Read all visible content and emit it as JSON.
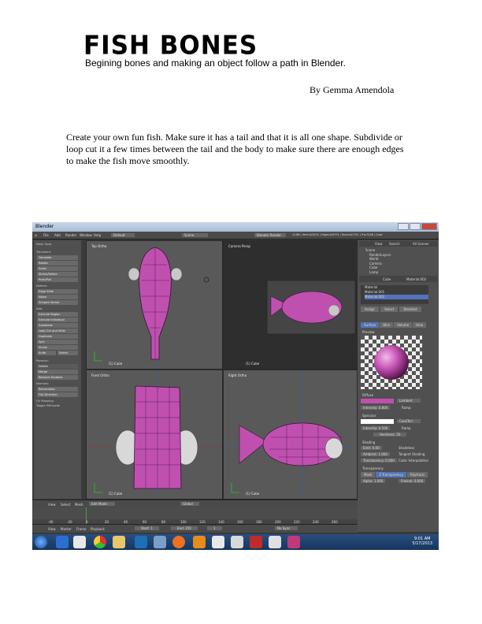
{
  "heading": {
    "title": "FISH BONES",
    "subtitle": "Begining bones and making an object follow a path in Blender.",
    "author": "By Gemma Amendola"
  },
  "instructions": "Create your own fun fish. Make sure it has a tail and that it is all one shape. Subdivide or loop cut it a few times between the tail and the body to make sure there are enough edges to make the fish move smoothly.",
  "screenshot": {
    "window_title": "Blender",
    "menu": [
      "File",
      "Add",
      "Render",
      "Window",
      "Help"
    ],
    "layout": "Default",
    "scene": "Scene",
    "engine": "Blender Render",
    "stats": "v2.66 | Verts:0/2034 | Edges:0/3374 | Faces:0/1752 | Tris:3248 | Cube",
    "tools_header": "Mesh Tools",
    "tool_sections": [
      {
        "heading": "Transform:",
        "items": [
          "Translate",
          "Rotate",
          "Scale",
          "Shrink/Fatten",
          "Push/Pull"
        ]
      },
      {
        "heading": "Deform:",
        "items": [
          "Edge Slide",
          "Noise",
          "Smooth Vertex"
        ]
      },
      {
        "heading": "Add:",
        "items": [
          "Extrude Region",
          "Extrude Individual",
          "Subdivide",
          "Loop Cut and Slide",
          "Duplicate",
          "Spin",
          "Screw",
          "Knife"
        ]
      },
      {
        "heading": "Remove:",
        "items": [
          "Delete",
          "Merge",
          "Remove Doubles"
        ]
      },
      {
        "heading": "Normals:",
        "items": [
          "Recalculate",
          "Flip Direction"
        ]
      },
      {
        "heading": "UV Mapping:",
        "items": []
      }
    ],
    "toggle_editmode": "Toggle Editmode",
    "knife_select": "Select",
    "viewports": [
      {
        "label": "Top Ortho",
        "obj": "(1) Cube"
      },
      {
        "label": "Camera Persp",
        "obj": "(1) Cube"
      },
      {
        "label": "Front Ortho",
        "obj": "(1) Cube"
      },
      {
        "label": "Right Ortho",
        "obj": "(1) Cube"
      }
    ],
    "view_bar": [
      "View",
      "Select",
      "Mesh",
      "Edit Mode",
      "Global"
    ],
    "outliner": {
      "tabs": [
        "View",
        "Search",
        "All Scenes"
      ],
      "items": [
        "Scene",
        "RenderLayers",
        "World",
        "Camera",
        "Cube",
        "Lamp"
      ]
    },
    "material_object": "Cube",
    "material_name": "Material.002",
    "materials": [
      "Material",
      "Material.001",
      "Material.002"
    ],
    "material_buttons": [
      "Assign",
      "Select",
      "Deselect"
    ],
    "material_tabs": [
      "Surface",
      "Wire",
      "Volume",
      "Halo"
    ],
    "preview_label": "Preview",
    "diffuse": {
      "label": "Diffuse",
      "shader": "Lambert",
      "intensity": "Intensity: 0.800",
      "ramp": "Ramp"
    },
    "specular": {
      "label": "Specular",
      "shader": "CookTorr",
      "intensity": "Intensity: 0.500",
      "ramp": "Ramp",
      "hardness": "Hardness: 50"
    },
    "shading": {
      "label": "Shading",
      "emit": "Emit: 0.00",
      "ambient": "Ambient: 1.000",
      "translucency": "Translucency: 0.000",
      "shadeless": "Shadeless",
      "tangent": "Tangent Shading",
      "cubic": "Cubic Interpolation"
    },
    "transparency": {
      "label": "Transparency",
      "tabs": [
        "Mask",
        "Z Transparency",
        "Raytrace"
      ],
      "alpha": "Alpha: 1.000",
      "fresnel": "Fresnel: 0.000"
    },
    "timeline_bar": [
      "View",
      "Marker",
      "Frame",
      "Playback"
    ],
    "start": "Start: 1",
    "end": "End: 250",
    "current_frame": "1",
    "sync": "No Sync",
    "ruler_ticks": [
      "-40",
      "-20",
      "0",
      "20",
      "40",
      "60",
      "80",
      "100",
      "120",
      "140",
      "160",
      "180",
      "200",
      "220",
      "240",
      "260"
    ],
    "clock_time": "9:01 AM",
    "clock_date": "5/17/2013"
  },
  "colors": {
    "mesh": "#c050b0",
    "viewport": "#595959",
    "panel": "#505050",
    "taskbar": "#1e4270"
  }
}
